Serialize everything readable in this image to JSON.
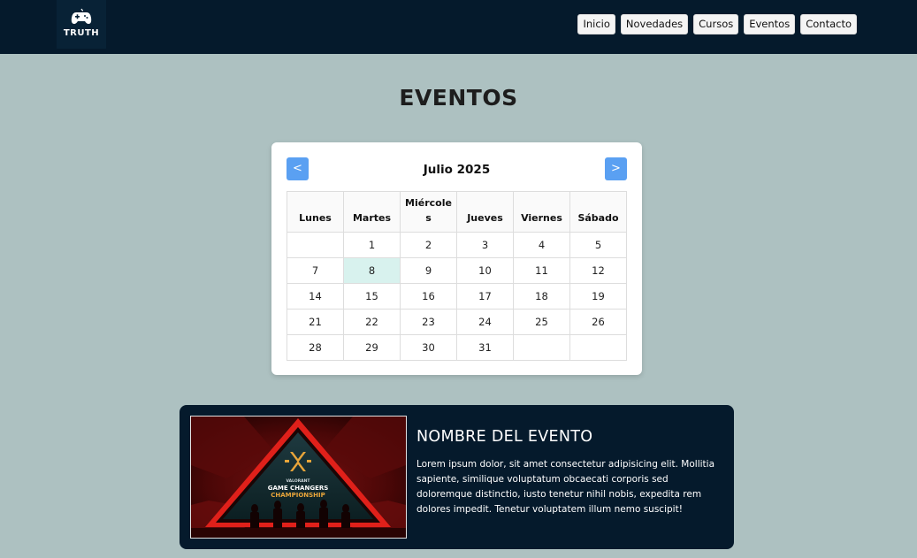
{
  "header": {
    "logo_text": "TRUTH",
    "nav": [
      "Inicio",
      "Novedades",
      "Cursos",
      "Eventos",
      "Contacto"
    ]
  },
  "page": {
    "title": "EVENTOS"
  },
  "calendar": {
    "month": "Julio 2025",
    "prev_label": "<",
    "next_label": ">",
    "weekdays": [
      "Lunes",
      "Martes",
      "Miércoles",
      "Jueves",
      "Viernes",
      "Sábado"
    ],
    "weeks": [
      [
        "",
        "1",
        "2",
        "3",
        "4",
        "5"
      ],
      [
        "7",
        "8",
        "9",
        "10",
        "11",
        "12"
      ],
      [
        "14",
        "15",
        "16",
        "17",
        "18",
        "19"
      ],
      [
        "21",
        "22",
        "23",
        "24",
        "25",
        "26"
      ],
      [
        "28",
        "29",
        "30",
        "31",
        "",
        ""
      ]
    ],
    "highlighted_day": "8"
  },
  "event": {
    "title": "NOMBRE DEL EVENTO",
    "description": "Lorem ipsum dolor, sit amet consectetur adipisicing elit. Mollitia sapiente, similique voluptatum obcaecati corporis sed doloremque distinctio, iusto tenetur nihil nobis, expedita rem dolores impedit. Tenetur voluptatem illum nemo suscipit!",
    "image_text": {
      "line1": "VALORANT",
      "line2": "GAME CHANGERS",
      "line3": "CHAMPIONSHIP"
    }
  },
  "colors": {
    "header_bg": "#051a2c",
    "page_bg": "#adc1c1",
    "accent": "#5aa0f2",
    "today_bg": "#d8f2ee"
  }
}
